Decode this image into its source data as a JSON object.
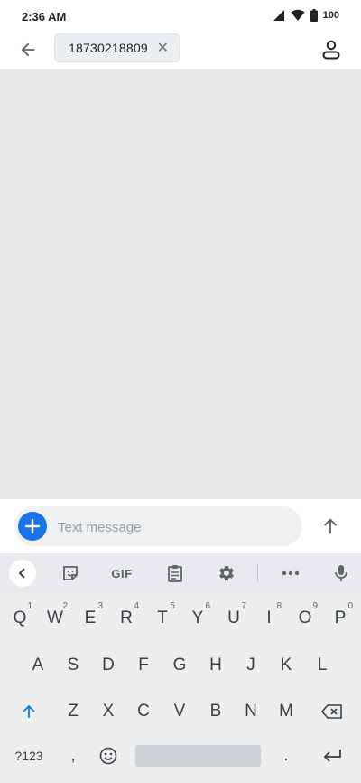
{
  "status_bar": {
    "time": "2:36 AM",
    "battery": "100"
  },
  "header": {
    "recipient": "18730218809"
  },
  "composer": {
    "placeholder": "Text message"
  },
  "keyboard": {
    "toolbar": {
      "gif_label": "GIF"
    },
    "rows": [
      [
        {
          "label": "Q",
          "hint": "1"
        },
        {
          "label": "W",
          "hint": "2"
        },
        {
          "label": "E",
          "hint": "3"
        },
        {
          "label": "R",
          "hint": "4"
        },
        {
          "label": "T",
          "hint": "5"
        },
        {
          "label": "Y",
          "hint": "6"
        },
        {
          "label": "U",
          "hint": "7"
        },
        {
          "label": "I",
          "hint": "8"
        },
        {
          "label": "O",
          "hint": "9"
        },
        {
          "label": "P",
          "hint": "0"
        }
      ],
      [
        {
          "label": "A"
        },
        {
          "label": "S"
        },
        {
          "label": "D"
        },
        {
          "label": "F"
        },
        {
          "label": "G"
        },
        {
          "label": "H"
        },
        {
          "label": "J"
        },
        {
          "label": "K"
        },
        {
          "label": "L"
        }
      ],
      [
        {
          "label": "Z"
        },
        {
          "label": "X"
        },
        {
          "label": "C"
        },
        {
          "label": "V"
        },
        {
          "label": "B"
        },
        {
          "label": "N"
        },
        {
          "label": "M"
        }
      ]
    ],
    "symbols_label": "?123",
    "comma_label": ",",
    "period_label": "."
  }
}
